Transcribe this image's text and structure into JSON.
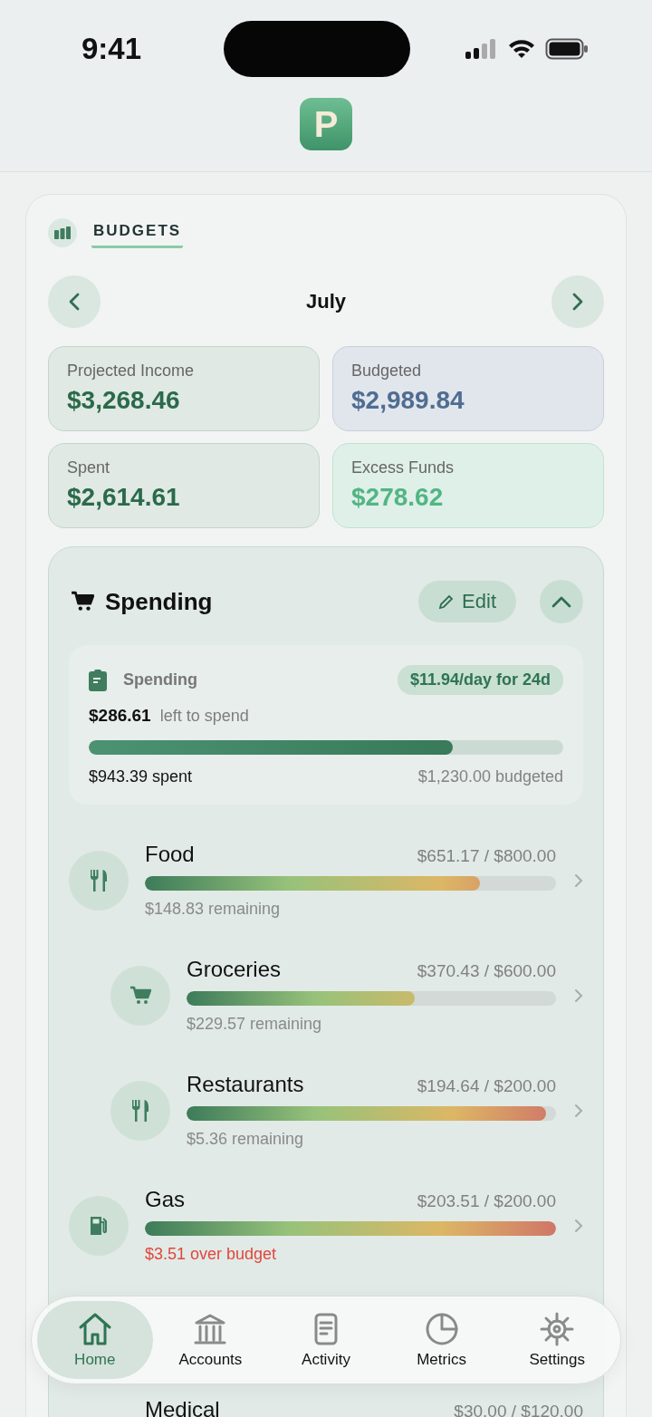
{
  "status_bar": {
    "time": "9:41"
  },
  "app": {
    "logo_letter": "P"
  },
  "budgets": {
    "title": "BUDGETS",
    "month": "July",
    "stats": [
      {
        "kind": "income",
        "label": "Projected Income",
        "value": "$3,268.46"
      },
      {
        "kind": "budgeted",
        "label": "Budgeted",
        "value": "$2,989.84"
      },
      {
        "kind": "spent",
        "label": "Spent",
        "value": "$2,614.61"
      },
      {
        "kind": "excess",
        "label": "Excess Funds",
        "value": "$278.62"
      }
    ]
  },
  "spending": {
    "title": "Spending",
    "edit_label": "Edit",
    "expanded": true,
    "summary": {
      "title": "Spending",
      "rate": "$11.94/day for 24d",
      "left_amount": "$286.61",
      "left_label": "left to spend",
      "level": 0.767,
      "spent": "$943.39 spent",
      "budgeted": "$1,230.00 budgeted"
    },
    "categories": [
      {
        "kind": "utensils",
        "name": "Food",
        "amount": "$651.17 / $800.00",
        "level": 0.814,
        "note": "$148.83 remaining",
        "over_budget": false,
        "children": [
          {
            "kind": "cart",
            "name": "Groceries",
            "amount": "$370.43 / $600.00",
            "level": 0.617,
            "note": "$229.57 remaining",
            "over_budget": false
          },
          {
            "kind": "utensils",
            "name": "Restaurants",
            "amount": "$194.64 / $200.00",
            "level": 0.973,
            "note": "$5.36 remaining",
            "over_budget": false
          }
        ]
      },
      {
        "kind": "fuel",
        "name": "Gas",
        "amount": "$203.51 / $200.00",
        "level": 1,
        "note": "$3.51 over budget",
        "over_budget": true
      },
      {
        "kind": "partial",
        "name": "Medical",
        "amount": "$30.00 / $120.00"
      }
    ]
  },
  "tab_bar": [
    {
      "label": "Home",
      "selected": true
    },
    {
      "label": "Accounts",
      "selected": false
    },
    {
      "label": "Activity",
      "selected": false
    },
    {
      "label": "Metrics",
      "selected": false
    },
    {
      "label": "Settings",
      "selected": false
    }
  ]
}
